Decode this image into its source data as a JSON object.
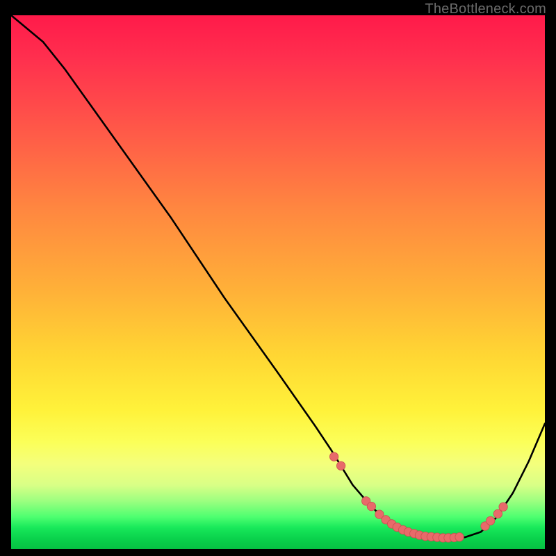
{
  "watermark": "TheBottleneck.com",
  "colors": {
    "line": "#000000",
    "marker_fill": "#e86a6a",
    "marker_stroke": "#c94f4f",
    "gradient_top": "#ff1a4a",
    "gradient_bottom": "#06c143"
  },
  "chart_data": {
    "type": "line",
    "title": "",
    "xlabel": "",
    "ylabel": "",
    "xlim": [
      0,
      100
    ],
    "ylim": [
      0,
      100
    ],
    "grid": false,
    "legend": false,
    "note": "Axis ticks and numeric labels are not rendered in the original image; x/y values are in 0-100 percent of the plot area, y measured from the bottom (0) to the top (100).",
    "series": [
      {
        "name": "curve",
        "x": [
          0,
          6,
          10,
          20,
          30,
          40,
          50,
          57,
          60,
          64,
          67,
          70,
          73,
          76,
          79,
          82,
          85,
          88,
          91,
          94,
          97,
          100
        ],
        "y": [
          100,
          95,
          90,
          76,
          62,
          47,
          33,
          23,
          18.5,
          12,
          8.5,
          5.5,
          3.6,
          2.5,
          2.1,
          2.0,
          2.2,
          3.2,
          6.0,
          10.5,
          16.5,
          23.5
        ]
      }
    ],
    "markers": {
      "name": "highlight-points",
      "note": "Pink/red circular markers clustered near the valley of the curve",
      "x": [
        60.5,
        61.8,
        66.5,
        67.5,
        69.0,
        70.2,
        71.3,
        72.3,
        73.4,
        74.4,
        75.5,
        76.5,
        77.6,
        78.7,
        79.8,
        80.9,
        81.9,
        83.0,
        84.0,
        88.8,
        89.8,
        91.2,
        92.2
      ],
      "y": [
        17.3,
        15.6,
        9.0,
        8.0,
        6.5,
        5.5,
        4.7,
        4.1,
        3.6,
        3.2,
        2.9,
        2.6,
        2.4,
        2.3,
        2.2,
        2.1,
        2.1,
        2.15,
        2.25,
        4.3,
        5.3,
        6.6,
        7.9
      ]
    }
  }
}
